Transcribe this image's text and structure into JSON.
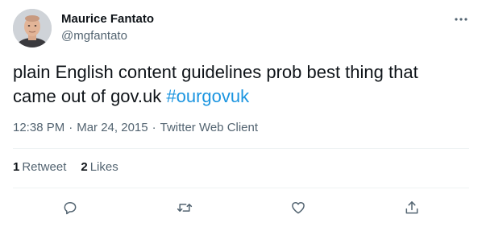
{
  "author": {
    "name": "Maurice Fantato",
    "handle": "@mgfantato"
  },
  "tweet": {
    "text": "plain English content guidelines prob best thing that came out of gov.uk ",
    "hashtag": "#ourgovuk",
    "time": "12:38 PM",
    "separator": "·",
    "date": "Mar 24, 2015",
    "client": "Twitter Web Client"
  },
  "stats": {
    "retweets_count": "1",
    "retweets_label": "Retweet",
    "likes_count": "2",
    "likes_label": "Likes"
  },
  "icons": {
    "more": "more-horizontal-icon",
    "reply": "reply-icon",
    "retweet": "retweet-icon",
    "like": "heart-icon",
    "share": "share-icon"
  },
  "colors": {
    "text": "#0f1419",
    "secondary": "#536471",
    "hashtag": "#1b95e0",
    "divider": "#eff3f4"
  }
}
